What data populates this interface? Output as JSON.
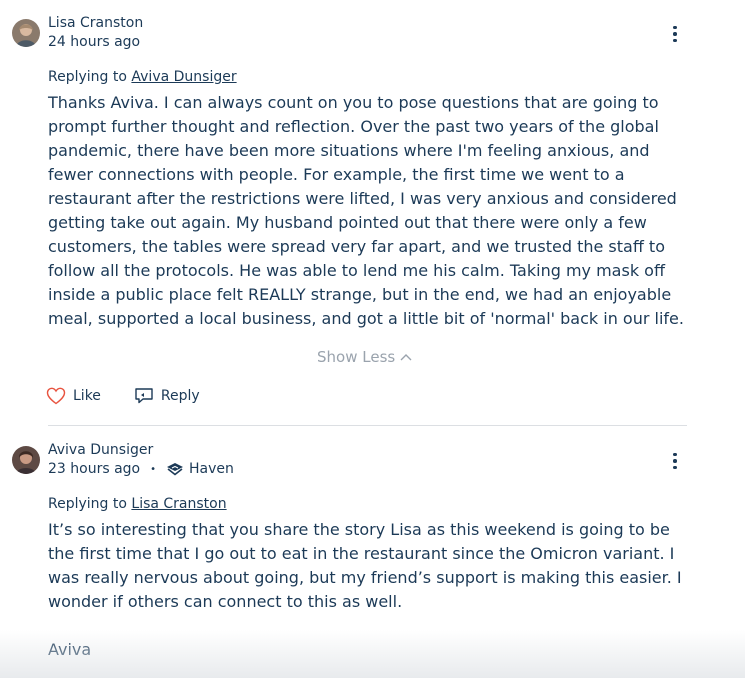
{
  "comments": [
    {
      "author": "Lisa Cranston",
      "time": "24 hours ago",
      "replying_prefix": "Replying to",
      "replying_to": "Aviva Dunsiger",
      "paragraphs": [
        "Thanks Aviva.  I can always count on you to pose questions that are going to prompt further thought and reflection. Over the past two years of the global pandemic, there have been more situations where I'm feeling anxious, and fewer connections with people.  For example, the first time we went to a restaurant after the restrictions were lifted, I was very anxious and considered getting take out again. My husband pointed out that there were only a few customers, the tables were spread very far apart, and we trusted the staff to follow all the protocols. He was able to lend me his calm. Taking my mask off inside a public place felt REALLY strange, but in the end, we had an enjoyable meal, supported a local business, and got a little bit of 'normal' back in our life."
      ],
      "show_less": "Show Less",
      "like_label": "Like",
      "reply_label": "Reply"
    },
    {
      "author": "Aviva Dunsiger",
      "time": "23 hours ago",
      "group": "Haven",
      "replying_prefix": "Replying to",
      "replying_to": "Lisa Cranston",
      "paragraphs": [
        "It’s so interesting that you share the story Lisa as this weekend is going to be the first time that I go out to eat in the restaurant since the Omicron variant. I was really nervous about going, but my friend’s support is making this easier. I wonder if others can connect to this as well.",
        "Aviva"
      ]
    }
  ],
  "icons": {
    "like": "heart-icon",
    "reply": "reply-icon",
    "more": "more-vertical-icon",
    "show_less": "chevron-up-icon",
    "group": "haven-icon"
  },
  "colors": {
    "text": "#1c3a57",
    "muted": "#9aa3ad",
    "like": "#e8533f",
    "divider": "#dcdfe3"
  }
}
